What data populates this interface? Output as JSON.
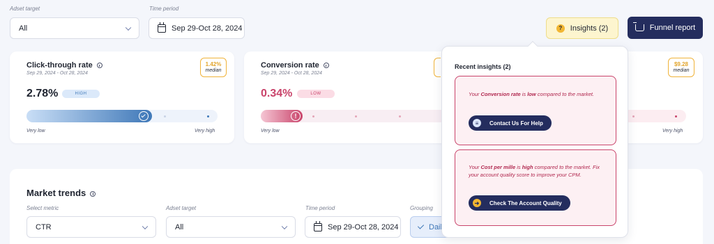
{
  "filters": {
    "adset_label": "Adset target",
    "adset_value": "All",
    "period_label": "Time period",
    "period_value": "Sep 29-Oct 28, 2024"
  },
  "header": {
    "insights_label": "Insights (2)",
    "funnel_label": "Funnel report"
  },
  "cards": [
    {
      "title": "Click-through rate",
      "range": "Sep 29, 2024 - Oct 28, 2024",
      "value": "2.78%",
      "level": "HIGH",
      "median_value": "1.42%",
      "median_label": "median",
      "scale_low": "Very low",
      "scale_high": "Very high"
    },
    {
      "title": "Conversion rate",
      "range": "Sep 29, 2024 - Oct 28, 2024",
      "value": "0.34%",
      "level": "LOW",
      "scale_low": "Very low"
    },
    {
      "median_value": "$9.28",
      "median_label": "median",
      "scale_high": "Very high"
    }
  ],
  "trends": {
    "title": "Market trends",
    "metric_label": "Select metric",
    "metric_value": "CTR",
    "adset_label": "Adset target",
    "adset_value": "All",
    "period_label": "Time period",
    "period_value": "Sep 29-Oct 28, 2024",
    "grouping_label": "Grouping",
    "grouping_value": "Daily"
  },
  "insights_popover": {
    "title": "Recent insights (2)",
    "items": [
      {
        "pre": "Your ",
        "metric": "Conversion rate",
        "mid": " is ",
        "level": "low",
        "post": " compared to the market.",
        "button": "Contact Us For Help"
      },
      {
        "pre": "Your ",
        "metric": "Cost per mille",
        "mid": " is ",
        "level": "high",
        "post": " compared to the market. Fix your account quality score to improve your CPM.",
        "button": "Check The Account Quality"
      }
    ]
  },
  "colors": {
    "brand_navy": "#242d5e",
    "high_blue": "#3f78b8",
    "low_red": "#c9446b",
    "median_orange": "#f0b33a",
    "insights_yellow": "#fdf5cf"
  }
}
